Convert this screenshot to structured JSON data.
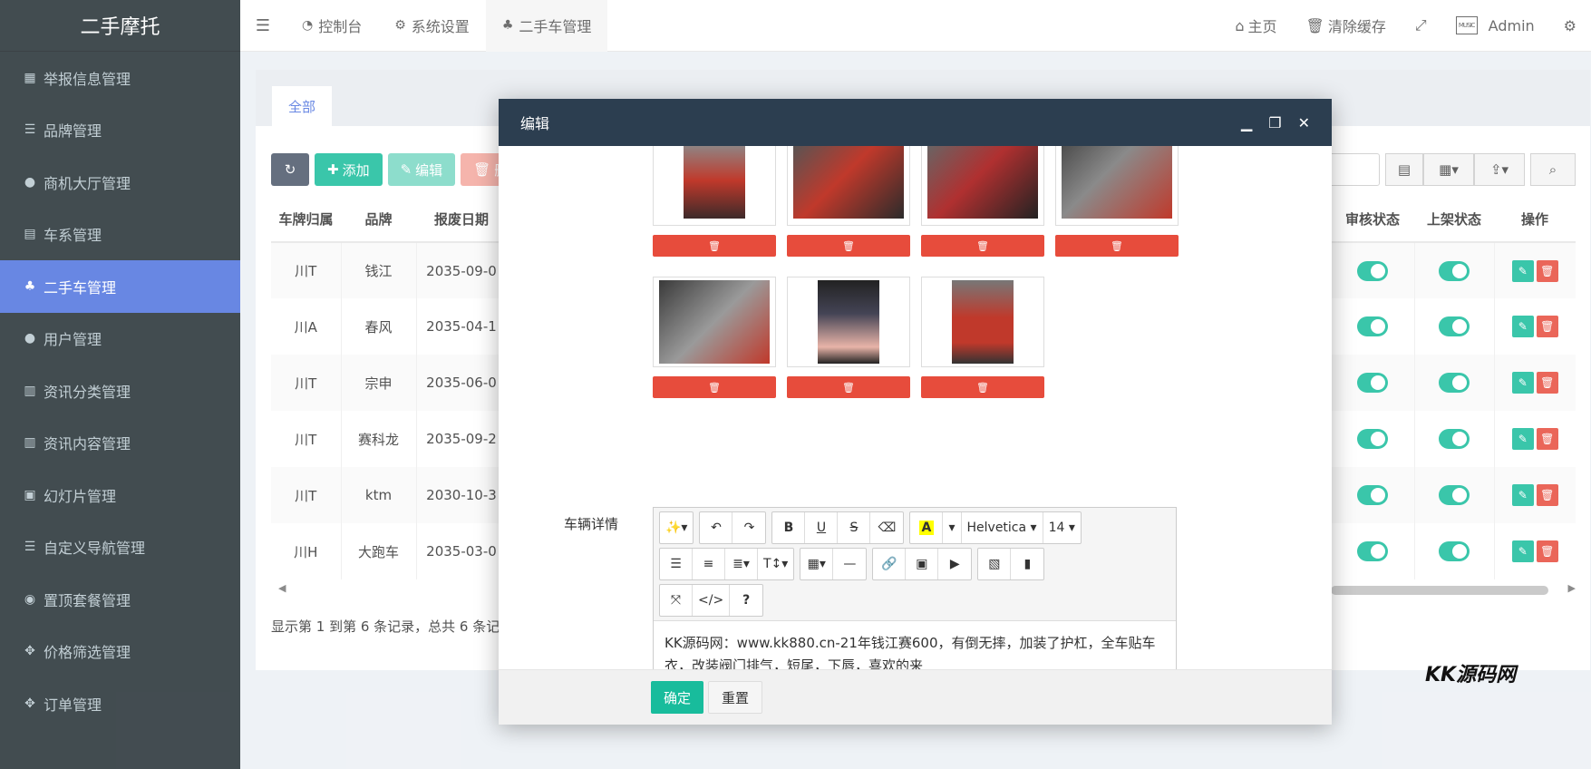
{
  "app": {
    "title": "二手摩托"
  },
  "sidebar": {
    "items": [
      {
        "label": "举报信息管理",
        "icon": "film-icon"
      },
      {
        "label": "品牌管理",
        "icon": "list-icon"
      },
      {
        "label": "商机大厅管理",
        "icon": "user-icon"
      },
      {
        "label": "车系管理",
        "icon": "server-icon"
      },
      {
        "label": "二手车管理",
        "icon": "sitemap-icon",
        "active": true
      },
      {
        "label": "用户管理",
        "icon": "user-icon"
      },
      {
        "label": "资讯分类管理",
        "icon": "newspaper-icon"
      },
      {
        "label": "资讯内容管理",
        "icon": "newspaper-icon"
      },
      {
        "label": "幻灯片管理",
        "icon": "image-icon"
      },
      {
        "label": "自定义导航管理",
        "icon": "list-icon"
      },
      {
        "label": "置顶套餐管理",
        "icon": "chevron-circle-icon"
      },
      {
        "label": "价格筛选管理",
        "icon": "arrows-icon"
      },
      {
        "label": "订单管理",
        "icon": "arrows-icon"
      }
    ]
  },
  "topbar": {
    "tabs": [
      {
        "label": "控制台",
        "icon": "dashboard-icon"
      },
      {
        "label": "系统设置",
        "icon": "cogs-icon"
      },
      {
        "label": "二手车管理",
        "icon": "sitemap-icon"
      }
    ],
    "home": "主页",
    "clear_cache": "清除缓存",
    "user": "Admin",
    "avatar_text": "MUSIC"
  },
  "panel": {
    "tab": "全部",
    "add": "添加",
    "edit": "编辑",
    "delete_partial": "删",
    "columns_left": [
      "车牌归属",
      "品牌",
      "报废日期"
    ],
    "columns_right": [
      "审核状态",
      "上架状态",
      "操作"
    ],
    "rows": [
      [
        "川T",
        "钱江",
        "2035-09-0"
      ],
      [
        "川A",
        "春风",
        "2035-04-1"
      ],
      [
        "川T",
        "宗申",
        "2035-06-0"
      ],
      [
        "川T",
        "赛科龙",
        "2035-09-2"
      ],
      [
        "川T",
        "ktm",
        "2030-10-3"
      ],
      [
        "川H",
        "大跑车",
        "2035-03-0"
      ]
    ],
    "footer": "显示第 1 到第 6 条记录，总共 6 条记"
  },
  "modal": {
    "title": "编辑",
    "field_label": "车辆详情",
    "editor": {
      "font": "Helvetica",
      "size": "14",
      "content": "KK源码网：www.kk880.cn-21年钱江赛600，有倒无摔，加装了护杠，全车贴车衣，改装阀门排气，短尾，下唇，喜欢的来"
    },
    "ok": "确定",
    "reset": "重置"
  },
  "watermark": "KK源码网",
  "colors": {
    "sidebar": "#222d32",
    "active": "#4e73df",
    "green": "#18bc9c",
    "red": "#e74c3c",
    "modal_head": "#2c3e50"
  }
}
